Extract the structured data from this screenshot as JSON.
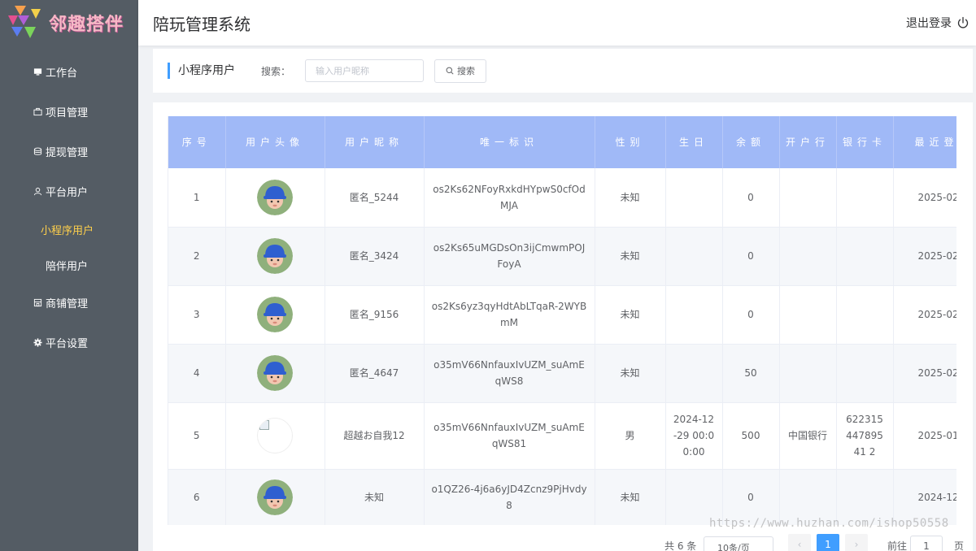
{
  "brand": {
    "logo_text": "邻趣搭伴"
  },
  "header": {
    "title": "陪玩管理系统",
    "logout_label": "退出登录"
  },
  "sidebar": {
    "items": [
      {
        "label": "工作台",
        "icon": "monitor-icon"
      },
      {
        "label": "项目管理",
        "icon": "briefcase-icon"
      },
      {
        "label": "提现管理",
        "icon": "coins-icon"
      },
      {
        "label": "平台用户",
        "icon": "user-icon"
      },
      {
        "label": "小程序用户",
        "sub": true,
        "active": true
      },
      {
        "label": "陪伴用户",
        "sub": true
      },
      {
        "label": "商铺管理",
        "icon": "shop-icon"
      },
      {
        "label": "平台设置",
        "icon": "gear-icon"
      }
    ]
  },
  "filter": {
    "title": "小程序用户",
    "search_label": "搜索：",
    "search_placeholder": "输入用户昵称",
    "search_button": "搜索"
  },
  "table": {
    "headers": [
      "序号",
      "用户头像",
      "用户昵称",
      "唯一标识",
      "性别",
      "生日",
      "余额",
      "开户行",
      "银行卡",
      "最近登"
    ],
    "rows": [
      {
        "index": "1",
        "avatar": "default",
        "nickname": "匿名_5244",
        "openid": "os2Ks62NFoyRxkdHYpwS0cfOdMJA",
        "gender": "未知",
        "birthday": "",
        "balance": "0",
        "bank": "",
        "card": "",
        "last_login": "2025-02-"
      },
      {
        "index": "2",
        "avatar": "default",
        "nickname": "匿名_3424",
        "openid": "os2Ks65uMGDsOn3ijCmwmPOJFoyA",
        "gender": "未知",
        "birthday": "",
        "balance": "0",
        "bank": "",
        "card": "",
        "last_login": "2025-02-"
      },
      {
        "index": "3",
        "avatar": "default",
        "nickname": "匿名_9156",
        "openid": "os2Ks6yz3qyHdtAbLTqaR-2WYBmM",
        "gender": "未知",
        "birthday": "",
        "balance": "0",
        "bank": "",
        "card": "",
        "last_login": "2025-02-"
      },
      {
        "index": "4",
        "avatar": "default",
        "nickname": "匿名_4647",
        "openid": "o35mV66NnfauxIvUZM_suAmEqWS8",
        "gender": "未知",
        "birthday": "",
        "balance": "50",
        "bank": "",
        "card": "",
        "last_login": "2025-02-"
      },
      {
        "index": "5",
        "avatar": "broken",
        "nickname": "超越お自我12",
        "openid": "o35mV66NnfauxIvUZM_suAmEqWS81",
        "gender": "男",
        "birthday": "2024-12-29 00:00:00",
        "balance": "500",
        "bank": "中国银行",
        "card": "62231544789541 2",
        "last_login": "2025-01-"
      },
      {
        "index": "6",
        "avatar": "default",
        "nickname": "未知",
        "openid": "o1QZ26-4j6a6yJD4Zcnz9PjHvdy8",
        "gender": "未知",
        "birthday": "",
        "balance": "0",
        "bank": "",
        "card": "",
        "last_login": "2024-12-"
      }
    ]
  },
  "pagination": {
    "total": "共 6 条",
    "page_size": "10条/页",
    "current_page": "1",
    "goto_prefix": "前往",
    "goto_value": "1",
    "goto_suffix": "页"
  },
  "watermark": "https://www.huzhan.com/ishop50558",
  "colors": {
    "sidebar": "#545c64",
    "active_menu": "#ffd04b",
    "table_header": "#a0b9f7",
    "primary": "#409eff"
  }
}
